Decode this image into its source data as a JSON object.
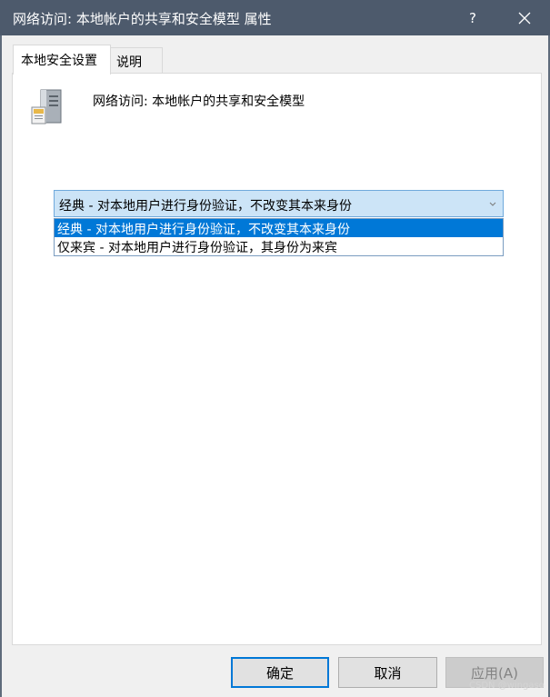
{
  "window": {
    "title": "网络访问: 本地帐户的共享和安全模型 属性",
    "help_label": "?",
    "close_icon": "close-icon"
  },
  "tabs": [
    {
      "label": "本地安全设置",
      "active": true
    },
    {
      "label": "说明",
      "active": false
    }
  ],
  "policy": {
    "icon": "server-icon",
    "name": "网络访问: 本地帐户的共享和安全模型"
  },
  "combo": {
    "selected": "经典 - 对本地用户进行身份验证，不改变其本来身份",
    "arrow_icon": "chevron-down-icon",
    "options": [
      {
        "label": "经典 - 对本地用户进行身份验证，不改变其本来身份",
        "highlighted": true
      },
      {
        "label": "仅来宾 - 对本地用户进行身份验证，其身份为来宾",
        "highlighted": false
      }
    ]
  },
  "buttons": {
    "ok": "确定",
    "cancel": "取消",
    "apply": "应用(A)"
  },
  "watermark": "CSDN @wingaso",
  "colors": {
    "titlebar": "#4d5a6c",
    "selection": "#0078d7",
    "combo_bg": "#cce4f7"
  }
}
